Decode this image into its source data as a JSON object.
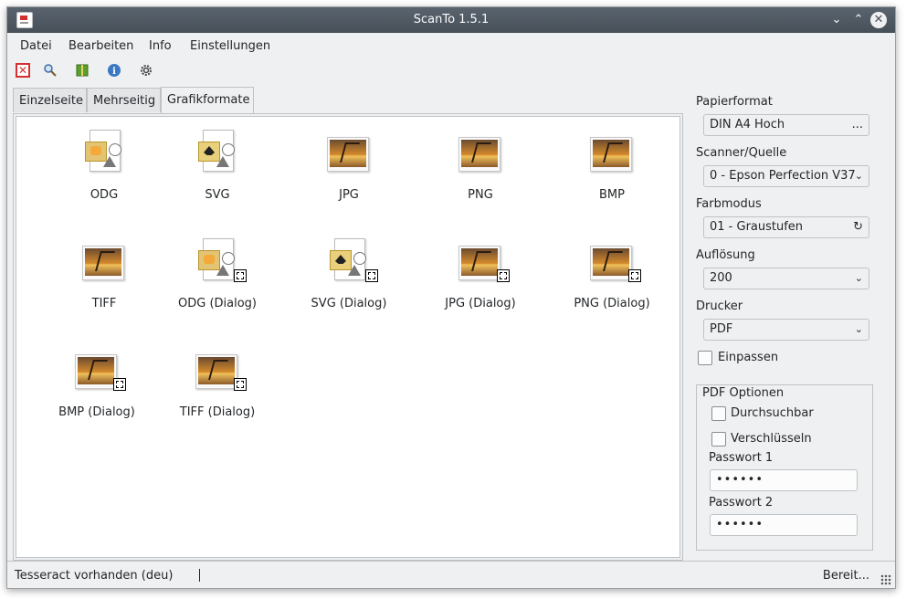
{
  "window": {
    "title": "ScanTo 1.5.1"
  },
  "menu": [
    "Datei",
    "Bearbeiten",
    "Info",
    "Einstellungen"
  ],
  "toolbar": {
    "icons": [
      "close-doc-icon",
      "search-icon",
      "book-icon",
      "info-icon",
      "gear-icon"
    ]
  },
  "tabs": [
    "Einzelseite",
    "Mehrseitig",
    "Grafikformate"
  ],
  "formats": [
    {
      "label": "ODG",
      "kind": "doc"
    },
    {
      "label": "SVG",
      "kind": "docsvg"
    },
    {
      "label": "JPG",
      "kind": "img"
    },
    {
      "label": "PNG",
      "kind": "img"
    },
    {
      "label": "BMP",
      "kind": "img"
    },
    {
      "label": "TIFF",
      "kind": "img"
    },
    {
      "label": "ODG (Dialog)",
      "kind": "doc",
      "dialog": true
    },
    {
      "label": "SVG (Dialog)",
      "kind": "docsvg",
      "dialog": true
    },
    {
      "label": "JPG (Dialog)",
      "kind": "img",
      "dialog": true
    },
    {
      "label": "PNG (Dialog)",
      "kind": "img",
      "dialog": true
    },
    {
      "label": "BMP (Dialog)",
      "kind": "img",
      "dialog": true
    },
    {
      "label": "TIFF (Dialog)",
      "kind": "img",
      "dialog": true
    }
  ],
  "sidebar": {
    "papierformat_label": "Papierformat",
    "papierformat_value": "DIN A4 Hoch",
    "papierformat_btn": "...",
    "scanner_label": "Scanner/Quelle",
    "scanner_value": "0 - Epson Perfection V37",
    "farbmodus_label": "Farbmodus",
    "farbmodus_value": "01 - Graustufen",
    "aufloesung_label": "Auflösung",
    "aufloesung_value": "200",
    "drucker_label": "Drucker",
    "drucker_value": "PDF",
    "einpassen_label": "Einpassen"
  },
  "pdf": {
    "group_title": "PDF Optionen",
    "durchsuchbar_label": "Durchsuchbar",
    "verschluesseln_label": "Verschlüsseln",
    "pw1_label": "Passwort 1",
    "pw1_value": "••••••",
    "pw2_label": "Passwort 2",
    "pw2_value": "••••••"
  },
  "status": {
    "left": "Tesseract vorhanden (deu)",
    "right": "Bereit..."
  }
}
